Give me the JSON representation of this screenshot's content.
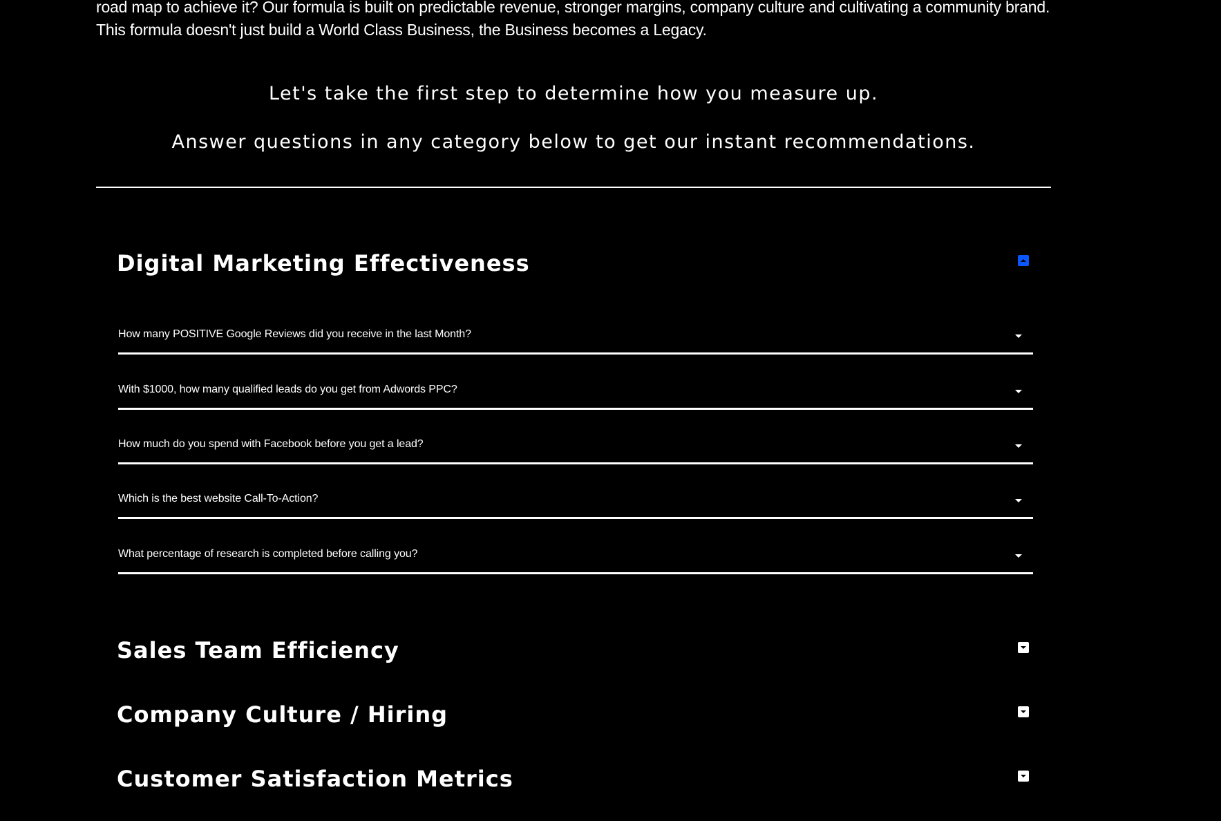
{
  "intro": {
    "text": "road map to achieve it? Our formula is built on predictable revenue, stronger margins, company culture and cultivating a community brand. This formula doesn't just build a World Class Business, the Business becomes a Legacy."
  },
  "lead": {
    "line1": "Let's take the first step to determine how you measure up.",
    "line2": "Answer questions in any category below to get our instant recommendations."
  },
  "sections": [
    {
      "title": "Digital Marketing Effectiveness",
      "state": "expanded",
      "toggle_icon": "chevron-up-icon",
      "questions": [
        "How many POSITIVE Google Reviews did you receive in the last Month?",
        "With $1000, how many qualified leads do you get from Adwords PPC?",
        "How much do you spend with Facebook before you get a lead?",
        "Which is the best website Call-To-Action?",
        "What percentage of research is completed before calling you?"
      ]
    },
    {
      "title": "Sales Team Efficiency",
      "state": "collapsed",
      "toggle_icon": "chevron-down-icon"
    },
    {
      "title": "Company Culture / Hiring",
      "state": "collapsed",
      "toggle_icon": "chevron-down-icon"
    },
    {
      "title": "Customer Satisfaction Metrics",
      "state": "collapsed",
      "toggle_icon": "chevron-down-icon"
    }
  ],
  "colors": {
    "background": "#000000",
    "text": "#ffffff",
    "accent": "#0a57ff"
  }
}
